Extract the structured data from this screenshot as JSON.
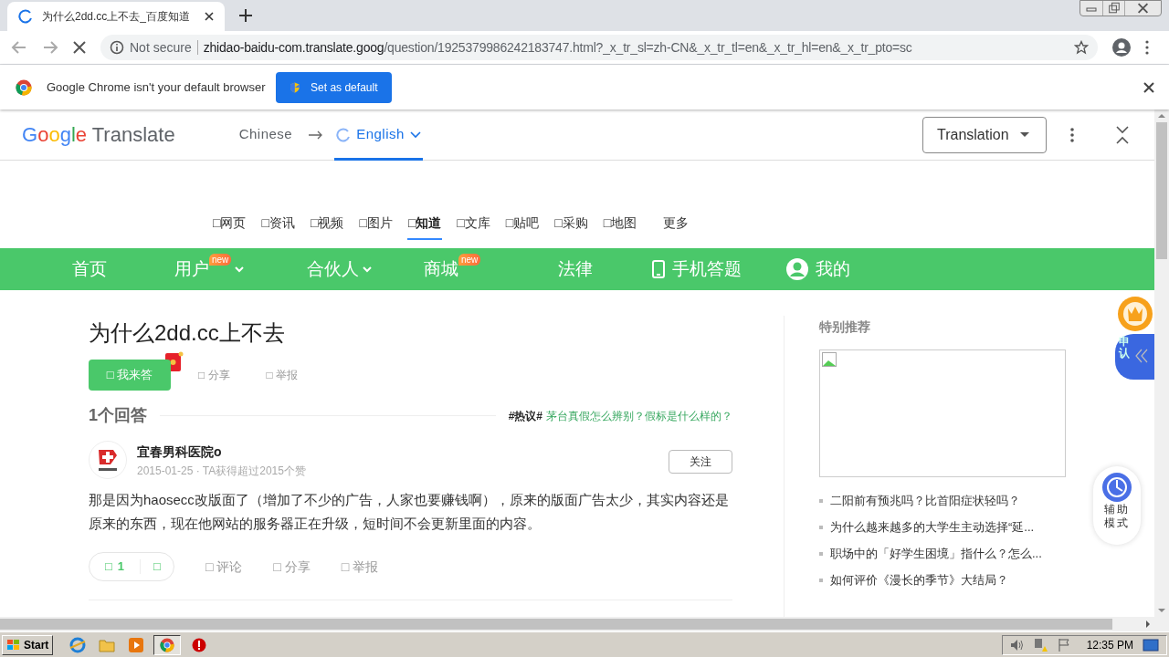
{
  "browser": {
    "tab": {
      "title": "为什么2dd.cc上不去_百度知道",
      "loading": true
    },
    "address": {
      "security": "Not secure",
      "host": "zhidao-baidu-com.translate.goog",
      "path": "/question/1925379986242183747.html?_x_tr_sl=zh-CN&_x_tr_tl=en&_x_tr_hl=en&_x_tr_pto=sc"
    }
  },
  "infobar": {
    "message": "Google Chrome isn't your default browser",
    "button": "Set as default"
  },
  "translate_bar": {
    "logo_google": "Google",
    "logo_product": "Translate",
    "languages": [
      {
        "label": "Chinese",
        "selected": false
      },
      {
        "label": "English",
        "selected": true
      }
    ],
    "mode": "Translation"
  },
  "search_tabs": [
    {
      "label": "□网页",
      "selected": false
    },
    {
      "label": "□资讯",
      "selected": false
    },
    {
      "label": "□视频",
      "selected": false
    },
    {
      "label": "□图片",
      "selected": false
    },
    {
      "label": "□知道",
      "selected": true
    },
    {
      "label": "□文库",
      "selected": false
    },
    {
      "label": "□贴吧",
      "selected": false
    },
    {
      "label": "□采购",
      "selected": false
    },
    {
      "label": "□地图",
      "selected": false
    },
    {
      "label": "更多",
      "selected": false
    }
  ],
  "nav": [
    {
      "label": "首页",
      "kind": "text",
      "dropdown": false
    },
    {
      "label": "用户",
      "kind": "text",
      "badge": "new",
      "dropdown": true
    },
    {
      "label": "合伙人",
      "kind": "text",
      "dropdown": true
    },
    {
      "label": "商城",
      "kind": "text",
      "badge": "new",
      "dropdown": false
    },
    {
      "label": "法律",
      "kind": "text",
      "dropdown": false
    },
    {
      "label": "手机答题",
      "kind": "phone",
      "dropdown": false
    },
    {
      "label": "我的",
      "kind": "user",
      "dropdown": false
    }
  ],
  "question": {
    "title": "为什么2dd.cc上不去",
    "actions": [
      {
        "label": "□ 我来答",
        "kind": "primary"
      },
      {
        "label": "□ 分享",
        "kind": "link"
      },
      {
        "label": "□ 举报",
        "kind": "link"
      }
    ]
  },
  "answers_heading": "1个回答",
  "hot_topic": {
    "tag": "#热议#",
    "text": "茅台真假怎么辨别？假标是什么样的？"
  },
  "answer": {
    "author": "宜春男科医院o",
    "meta": "2015-01-25 · TA获得超过2015个赞",
    "follow": "关注",
    "body": "那是因为haosecc改版面了（增加了不少的广告，人家也要赚钱啊），原来的版面广告太少，其实内容还是原来的东西，现在他网站的服务器正在升级，短时间不会更新里面的内容。",
    "votes": {
      "up": "□",
      "count": "1",
      "down": "□"
    },
    "actions": [
      "□ 评论",
      "□ 分享",
      "□ 举报"
    ]
  },
  "sidebar": {
    "title": "特别推荐",
    "links": [
      "二阳前有预兆吗？比首阳症状轻吗？",
      "为什么越来越多的大学生主动选择“延...",
      "职场中的「好学生困境」指什么？怎么...",
      "如何评价《漫长的季节》大结局？"
    ]
  },
  "side_widgets": {
    "badge_text": [
      "申",
      "认"
    ],
    "assist": [
      "辅助",
      "模式"
    ]
  },
  "taskbar": {
    "start": "Start",
    "time": "12:35 PM"
  }
}
